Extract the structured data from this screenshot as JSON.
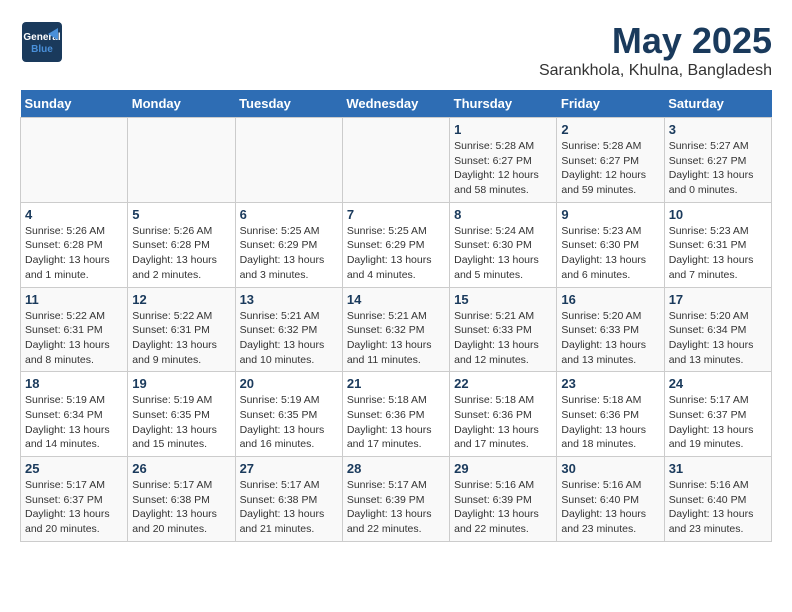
{
  "header": {
    "logo_line1": "General",
    "logo_line2": "Blue",
    "title": "May 2025",
    "subtitle": "Sarankhola, Khulna, Bangladesh"
  },
  "weekdays": [
    "Sunday",
    "Monday",
    "Tuesday",
    "Wednesday",
    "Thursday",
    "Friday",
    "Saturday"
  ],
  "weeks": [
    [
      {
        "day": "",
        "info": ""
      },
      {
        "day": "",
        "info": ""
      },
      {
        "day": "",
        "info": ""
      },
      {
        "day": "",
        "info": ""
      },
      {
        "day": "1",
        "info": "Sunrise: 5:28 AM\nSunset: 6:27 PM\nDaylight: 12 hours\nand 58 minutes."
      },
      {
        "day": "2",
        "info": "Sunrise: 5:28 AM\nSunset: 6:27 PM\nDaylight: 12 hours\nand 59 minutes."
      },
      {
        "day": "3",
        "info": "Sunrise: 5:27 AM\nSunset: 6:27 PM\nDaylight: 13 hours\nand 0 minutes."
      }
    ],
    [
      {
        "day": "4",
        "info": "Sunrise: 5:26 AM\nSunset: 6:28 PM\nDaylight: 13 hours\nand 1 minute."
      },
      {
        "day": "5",
        "info": "Sunrise: 5:26 AM\nSunset: 6:28 PM\nDaylight: 13 hours\nand 2 minutes."
      },
      {
        "day": "6",
        "info": "Sunrise: 5:25 AM\nSunset: 6:29 PM\nDaylight: 13 hours\nand 3 minutes."
      },
      {
        "day": "7",
        "info": "Sunrise: 5:25 AM\nSunset: 6:29 PM\nDaylight: 13 hours\nand 4 minutes."
      },
      {
        "day": "8",
        "info": "Sunrise: 5:24 AM\nSunset: 6:30 PM\nDaylight: 13 hours\nand 5 minutes."
      },
      {
        "day": "9",
        "info": "Sunrise: 5:23 AM\nSunset: 6:30 PM\nDaylight: 13 hours\nand 6 minutes."
      },
      {
        "day": "10",
        "info": "Sunrise: 5:23 AM\nSunset: 6:31 PM\nDaylight: 13 hours\nand 7 minutes."
      }
    ],
    [
      {
        "day": "11",
        "info": "Sunrise: 5:22 AM\nSunset: 6:31 PM\nDaylight: 13 hours\nand 8 minutes."
      },
      {
        "day": "12",
        "info": "Sunrise: 5:22 AM\nSunset: 6:31 PM\nDaylight: 13 hours\nand 9 minutes."
      },
      {
        "day": "13",
        "info": "Sunrise: 5:21 AM\nSunset: 6:32 PM\nDaylight: 13 hours\nand 10 minutes."
      },
      {
        "day": "14",
        "info": "Sunrise: 5:21 AM\nSunset: 6:32 PM\nDaylight: 13 hours\nand 11 minutes."
      },
      {
        "day": "15",
        "info": "Sunrise: 5:21 AM\nSunset: 6:33 PM\nDaylight: 13 hours\nand 12 minutes."
      },
      {
        "day": "16",
        "info": "Sunrise: 5:20 AM\nSunset: 6:33 PM\nDaylight: 13 hours\nand 13 minutes."
      },
      {
        "day": "17",
        "info": "Sunrise: 5:20 AM\nSunset: 6:34 PM\nDaylight: 13 hours\nand 13 minutes."
      }
    ],
    [
      {
        "day": "18",
        "info": "Sunrise: 5:19 AM\nSunset: 6:34 PM\nDaylight: 13 hours\nand 14 minutes."
      },
      {
        "day": "19",
        "info": "Sunrise: 5:19 AM\nSunset: 6:35 PM\nDaylight: 13 hours\nand 15 minutes."
      },
      {
        "day": "20",
        "info": "Sunrise: 5:19 AM\nSunset: 6:35 PM\nDaylight: 13 hours\nand 16 minutes."
      },
      {
        "day": "21",
        "info": "Sunrise: 5:18 AM\nSunset: 6:36 PM\nDaylight: 13 hours\nand 17 minutes."
      },
      {
        "day": "22",
        "info": "Sunrise: 5:18 AM\nSunset: 6:36 PM\nDaylight: 13 hours\nand 17 minutes."
      },
      {
        "day": "23",
        "info": "Sunrise: 5:18 AM\nSunset: 6:36 PM\nDaylight: 13 hours\nand 18 minutes."
      },
      {
        "day": "24",
        "info": "Sunrise: 5:17 AM\nSunset: 6:37 PM\nDaylight: 13 hours\nand 19 minutes."
      }
    ],
    [
      {
        "day": "25",
        "info": "Sunrise: 5:17 AM\nSunset: 6:37 PM\nDaylight: 13 hours\nand 20 minutes."
      },
      {
        "day": "26",
        "info": "Sunrise: 5:17 AM\nSunset: 6:38 PM\nDaylight: 13 hours\nand 20 minutes."
      },
      {
        "day": "27",
        "info": "Sunrise: 5:17 AM\nSunset: 6:38 PM\nDaylight: 13 hours\nand 21 minutes."
      },
      {
        "day": "28",
        "info": "Sunrise: 5:17 AM\nSunset: 6:39 PM\nDaylight: 13 hours\nand 22 minutes."
      },
      {
        "day": "29",
        "info": "Sunrise: 5:16 AM\nSunset: 6:39 PM\nDaylight: 13 hours\nand 22 minutes."
      },
      {
        "day": "30",
        "info": "Sunrise: 5:16 AM\nSunset: 6:40 PM\nDaylight: 13 hours\nand 23 minutes."
      },
      {
        "day": "31",
        "info": "Sunrise: 5:16 AM\nSunset: 6:40 PM\nDaylight: 13 hours\nand 23 minutes."
      }
    ]
  ]
}
